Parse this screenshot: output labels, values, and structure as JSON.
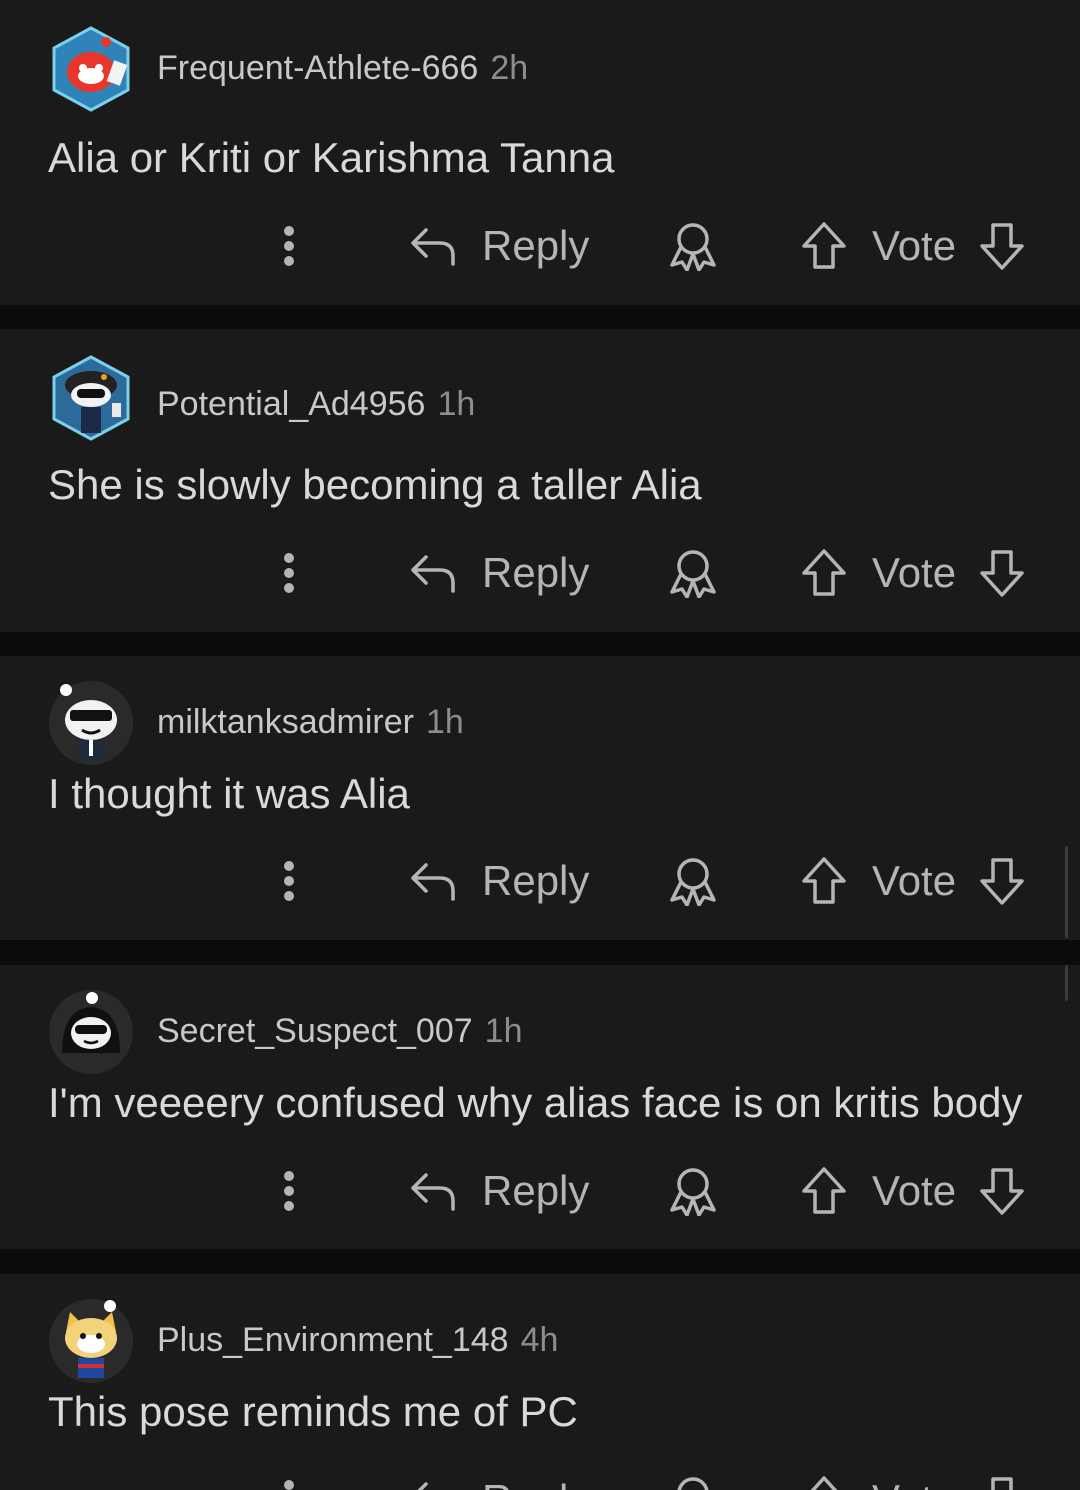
{
  "comments": [
    {
      "username": "Frequent-Athlete-666",
      "time": "2h",
      "text": "Alia or Kriti or Karishma Tanna",
      "reply_label": "Reply",
      "vote_label": "Vote"
    },
    {
      "username": "Potential_Ad4956",
      "time": "1h",
      "text": "She is slowly becoming a taller Alia",
      "reply_label": "Reply",
      "vote_label": "Vote"
    },
    {
      "username": "milktanksadmirer",
      "time": "1h",
      "text": "I thought it was Alia",
      "reply_label": "Reply",
      "vote_label": "Vote"
    },
    {
      "username": "Secret_Suspect_007",
      "time": "1h",
      "text": "I'm veeeery confused why alias face is on kritis body",
      "reply_label": "Reply",
      "vote_label": "Vote"
    },
    {
      "username": "Plus_Environment_148",
      "time": "4h",
      "text": "This pose reminds me of PC",
      "reply_label": "Reply",
      "vote_label": "Vote"
    }
  ],
  "icons": {
    "more": "more-vertical-icon",
    "reply": "reply-arrow-icon",
    "award": "award-ribbon-icon",
    "upvote": "upvote-arrow-icon",
    "downvote": "downvote-arrow-icon"
  },
  "colors": {
    "background": "#0b0b0b",
    "card": "#1a1a1b",
    "username": "#c8c8c8",
    "timestamp": "#8d8d8d",
    "body_text": "#d7dadc",
    "action": "#b5b5b5"
  }
}
